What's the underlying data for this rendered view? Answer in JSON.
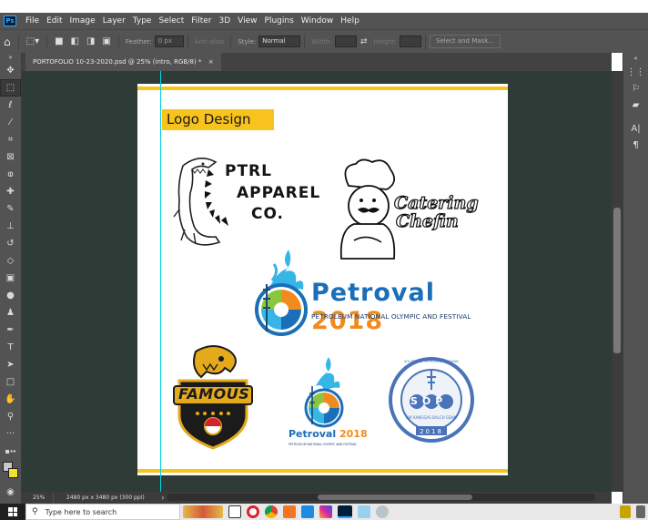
{
  "app": {
    "logo": "Ps"
  },
  "menu": [
    "File",
    "Edit",
    "Image",
    "Layer",
    "Type",
    "Select",
    "Filter",
    "3D",
    "View",
    "Plugins",
    "Window",
    "Help"
  ],
  "options": {
    "feather_label": "Feather:",
    "feather_value": "0 px",
    "antialias_label": "Anti-alias",
    "style_label": "Style:",
    "style_value": "Normal",
    "width_label": "Width:",
    "height_label": "Height:",
    "select_mask_label": "Select and Mask..."
  },
  "document": {
    "tab_title": "PORTOFOLIO 10-23-2020.psd @ 25% (intro, RGB/8) *",
    "close": "×"
  },
  "canvas": {
    "heading": "Logo Design",
    "logos": {
      "ptrl_line1": "PTRL",
      "ptrl_line2": "APPAREL",
      "ptrl_line3": "CO.",
      "catering_line1": "Catering",
      "catering_line2": "Chefin",
      "petroval_name": "Petroval",
      "petroval_year": "2018",
      "petroval_tagline": "PETROLEUM NATIONAL OLYMPIC AND FESTIVAL",
      "famous": "FAMOUS",
      "petroval_small_name": "Petroval",
      "petroval_small_year": "2018",
      "petroval_small_tagline": "PETROLEUM NATIONAL OLYMPIC AND FESTIVAL",
      "sop_letters": "SOP",
      "sop_ring_text": "SOCIETY OF PETROLEUM ENGINEERS",
      "sop_sub": "AIK KANGGAS BALCH GDAN",
      "sop_year": "2018"
    }
  },
  "status": {
    "zoom": "25%",
    "dimensions": "2480 px x 3480 px (300 ppi)",
    "arrow": "›"
  },
  "taskbar": {
    "search_placeholder": "Type here to search"
  },
  "tools": [
    "move-tool",
    "marquee-tool",
    "lasso-tool",
    "magic-wand-tool",
    "crop-tool",
    "frame-tool",
    "eyedropper-tool",
    "healing-brush-tool",
    "brush-tool",
    "clone-stamp-tool",
    "history-brush-tool",
    "eraser-tool",
    "gradient-tool",
    "blur-tool",
    "dodge-tool",
    "pen-tool",
    "type-tool",
    "path-selection-tool",
    "rectangle-tool",
    "hand-tool",
    "zoom-tool",
    "more-tools"
  ],
  "colors": {
    "accent_yellow": "#f7c31c",
    "petroval_blue": "#1a6fb8",
    "petroval_orange": "#f28b1e",
    "sop_blue": "#4a73b8",
    "guide_cyan": "#00d2e6"
  }
}
